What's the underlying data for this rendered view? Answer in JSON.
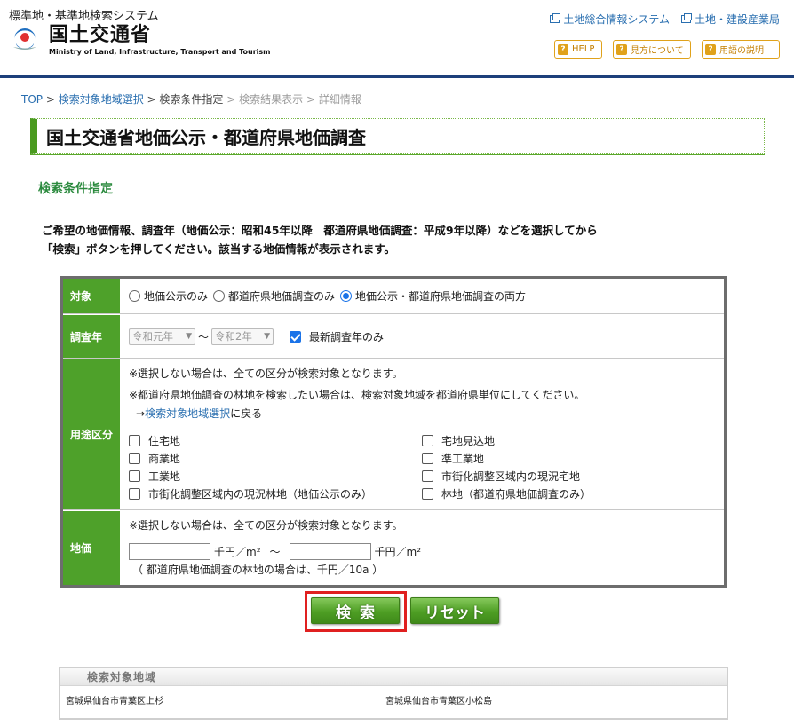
{
  "header": {
    "subtitle": "標準地・基準地検索システム",
    "logo_jp": "国土交通省",
    "logo_en": "Ministry of Land, Infrastructure, Transport and Tourism",
    "links": [
      "土地総合情報システム",
      "土地・建設産業局"
    ],
    "buttons": [
      "HELP",
      "見方について",
      "用語の説明"
    ]
  },
  "breadcrumb": {
    "top": "TOP",
    "sep": " > ",
    "area_select": "検索対象地域選択",
    "current": "検索条件指定",
    "results": "検索結果表示",
    "detail": "詳細情報"
  },
  "page_title": "国土交通省地価公示・都道府県地価調査",
  "section_title": "検索条件指定",
  "intro": {
    "line1": "ご希望の地価情報、調査年（地価公示：昭和45年以降　都道府県地価調査：平成9年以降）などを選択してから",
    "line2": "「検索」ボタンを押してください。該当する地価情報が表示されます。"
  },
  "form": {
    "target": {
      "label": "対象",
      "options": [
        "地価公示のみ",
        "都道府県地価調査のみ",
        "地価公示・都道府県地価調査の両方"
      ],
      "selected_index": 2
    },
    "year": {
      "label": "調査年",
      "from": "令和元年",
      "to": "令和2年",
      "tilde": "～",
      "latest_only_label": "最新調査年のみ",
      "latest_only_checked": true
    },
    "usage": {
      "label": "用途区分",
      "note1": "※選択しない場合は、全ての区分が検索対象となります。",
      "note2": "※都道府県地価調査の林地を検索したい場合は、検索対象地域を都道府県単位にしてください。",
      "back_arrow": "→",
      "back_link": "検索対象地域選択",
      "back_suffix": "に戻る",
      "left": [
        "住宅地",
        "商業地",
        "工業地",
        "市街化調整区域内の現況林地（地価公示のみ）"
      ],
      "right": [
        "宅地見込地",
        "準工業地",
        "市街化調整区域内の現況宅地",
        "林地（都道府県地価調査のみ）"
      ]
    },
    "price": {
      "label": "地価",
      "note": "※選択しない場合は、全ての区分が検索対象となります。",
      "from_value": "",
      "to_value": "",
      "unit": "千円／m²",
      "tilde": "～",
      "forest_note": "（ 都道府県地価調査の林地の場合は、千円／10a ）"
    }
  },
  "buttons": {
    "search": "検索",
    "reset": "リセット"
  },
  "area_box": {
    "title": "検索対象地域",
    "items": [
      "宮城県仙台市青葉区上杉",
      "宮城県仙台市青葉区小松島"
    ]
  }
}
